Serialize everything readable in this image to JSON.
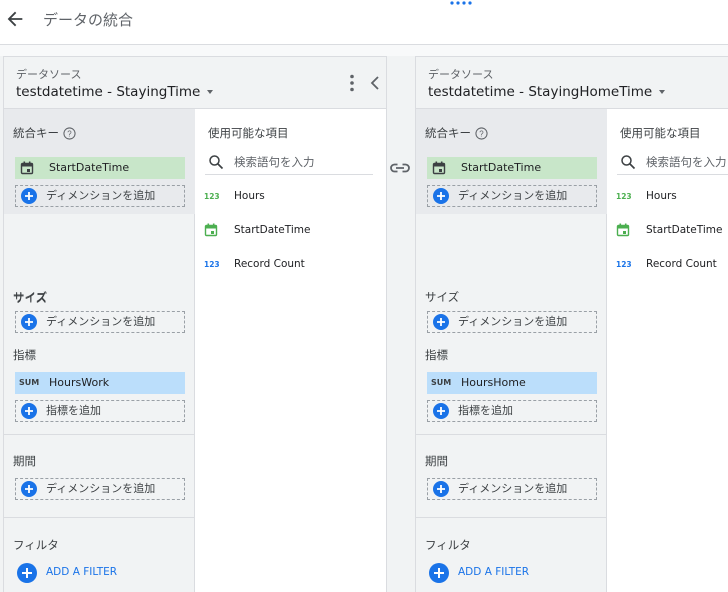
{
  "header": {
    "title": "データの統合",
    "back_icon": "arrow-back-icon",
    "more_icon": "more-horizontal-icon"
  },
  "link_icon": "link-icon",
  "panels": [
    {
      "source_label": "データソース",
      "source_name": "testdatetime - StayingTime",
      "join_key": {
        "title": "統合キー",
        "chip": "StartDateTime",
        "add": "ディメンションを追加"
      },
      "size": {
        "title": "サイズ",
        "add": "ディメンションを追加"
      },
      "metrics": {
        "title": "指標",
        "chip_agg": "SUM",
        "chip": "HoursWork",
        "add": "指標を追加"
      },
      "period": {
        "title": "期間",
        "add": "ディメンションを追加"
      },
      "filter": {
        "title": "フィルタ",
        "add": "ADD A FILTER"
      },
      "fields": {
        "title": "使用可能な項目",
        "search_placeholder": "検索語句を入力",
        "items": [
          {
            "type": "123",
            "label": "Hours"
          },
          {
            "type": "calendar",
            "label": "StartDateTime"
          },
          {
            "type": "123",
            "label": "Record Count"
          }
        ]
      }
    },
    {
      "source_label": "データソース",
      "source_name": "testdatetime - StayingHomeTime",
      "join_key": {
        "title": "統合キー",
        "chip": "StartDateTime",
        "add": "ディメンションを追加"
      },
      "size": {
        "title": "サイズ",
        "add": "ディメンションを追加"
      },
      "metrics": {
        "title": "指標",
        "chip_agg": "SUM",
        "chip": "HoursHome",
        "add": "指標を追加"
      },
      "period": {
        "title": "期間",
        "add": "ディメンションを追加"
      },
      "filter": {
        "title": "フィルタ",
        "add": "ADD A FILTER"
      },
      "fields": {
        "title": "使用可能な項目",
        "search_placeholder": "検索語句を入力",
        "items": [
          {
            "type": "123",
            "label": "Hours"
          },
          {
            "type": "calendar",
            "label": "StartDateTime"
          },
          {
            "type": "123",
            "label": "Record Count"
          }
        ]
      }
    }
  ],
  "colors": {
    "accent": "#1a73e8",
    "dimension_chip": "#c8e6c9",
    "metric_chip": "#bbdefb",
    "panel_bg": "#f1f3f4"
  }
}
